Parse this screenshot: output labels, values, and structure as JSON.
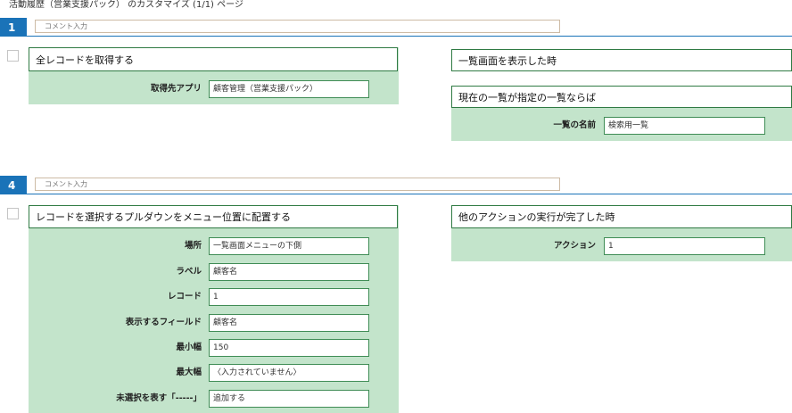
{
  "page_title": "活動履歴（営業支援パック） のカスタマイズ (1/1) ページ",
  "sections": [
    {
      "number": "1",
      "comment_placeholder": "コメント入力",
      "action": {
        "title": "全レコードを取得する",
        "fields": [
          {
            "label": "取得先アプリ",
            "value": "顧客管理（営業支援パック）"
          }
        ]
      },
      "trigger": {
        "title": "一覧画面を表示した時"
      },
      "condition": {
        "title": "現在の一覧が指定の一覧ならば",
        "fields": [
          {
            "label": "一覧の名前",
            "value": "検索用一覧"
          }
        ]
      }
    },
    {
      "number": "4",
      "comment_placeholder": "コメント入力",
      "action": {
        "title": "レコードを選択するプルダウンをメニュー位置に配置する",
        "fields": [
          {
            "label": "場所",
            "value": "一覧画面メニューの下側"
          },
          {
            "label": "ラベル",
            "value": "顧客名"
          },
          {
            "label": "レコード",
            "value": "1"
          },
          {
            "label": "表示するフィールド",
            "value": "顧客名"
          },
          {
            "label": "最小幅",
            "value": "150"
          },
          {
            "label": "最大幅",
            "value": "〈入力されていません〉"
          },
          {
            "label": "未選択を表す「-----」",
            "value": "追加する"
          }
        ]
      },
      "trigger": {
        "title": "他のアクションの実行が完了した時",
        "fields": [
          {
            "label": "アクション",
            "value": "1"
          }
        ]
      }
    }
  ],
  "colors": {
    "section_badge": "#1a73b8",
    "panel_bg": "#c3e4cb",
    "panel_border": "#2f7a43"
  }
}
